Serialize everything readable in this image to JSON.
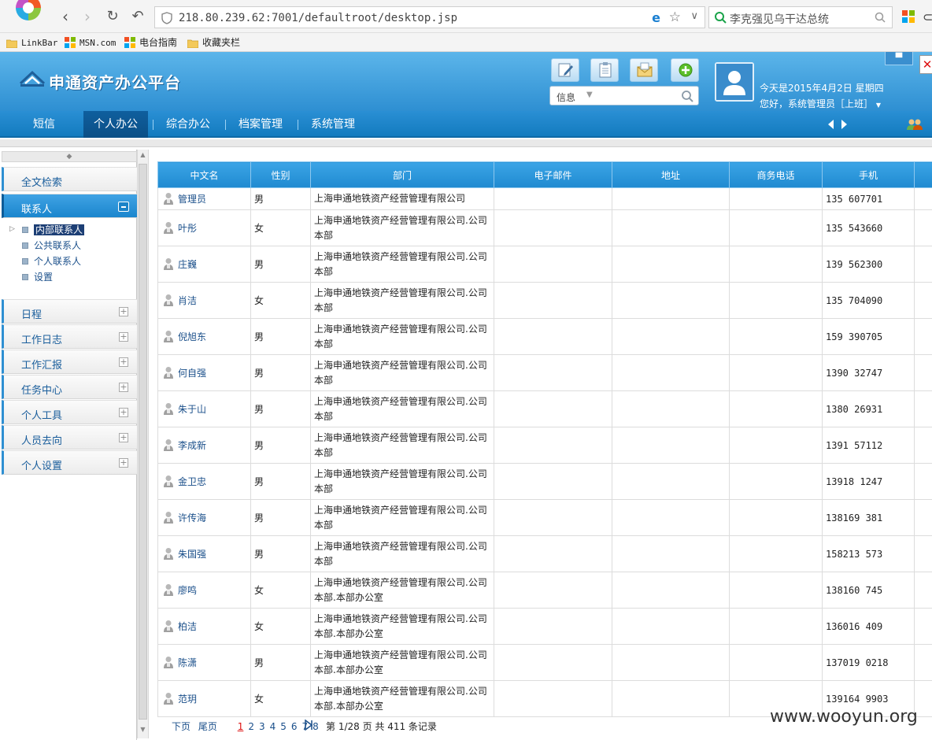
{
  "browser": {
    "url": "218.80.239.62:7001/defaultroot/desktop.jsp",
    "search_text": "李克强见乌干达总统"
  },
  "bookmarks": [
    "LinkBar",
    "MSN.com",
    "电台指南",
    "收藏夹栏"
  ],
  "app": {
    "title": "申通资产办公平台",
    "search_select": "信息",
    "date_text": "今天是2015年4月2日 星期四",
    "greeting": "您好，系统管理员［上班］"
  },
  "menu": {
    "items": [
      "短信",
      "个人办公",
      "综合办公",
      "档案管理",
      "系统管理"
    ],
    "active_index": 1
  },
  "sidebar": {
    "sections": [
      {
        "label": "全文检索"
      },
      {
        "label": "联系人"
      },
      {
        "label": "日程"
      },
      {
        "label": "工作日志"
      },
      {
        "label": "工作汇报"
      },
      {
        "label": "任务中心"
      },
      {
        "label": "个人工具"
      },
      {
        "label": "人员去向"
      },
      {
        "label": "个人设置"
      }
    ],
    "contact_items": [
      "内部联系人",
      "公共联系人",
      "个人联系人",
      "设置"
    ],
    "selected_contact": "内部联系人"
  },
  "table": {
    "columns": [
      "中文名",
      "性别",
      "部门",
      "电子邮件",
      "地址",
      "商务电话",
      "手机"
    ],
    "rows": [
      {
        "name": "管理员",
        "gender": "男",
        "dept": "上海申通地铁资产经营管理有限公司",
        "mobile": "135 607701"
      },
      {
        "name": "叶彤",
        "gender": "女",
        "dept": "上海申通地铁资产经营管理有限公司.公司本部",
        "mobile": "135 543660"
      },
      {
        "name": "庄巍",
        "gender": "男",
        "dept": "上海申通地铁资产经营管理有限公司.公司本部",
        "mobile": "139 562300"
      },
      {
        "name": "肖洁",
        "gender": "女",
        "dept": "上海申通地铁资产经营管理有限公司.公司本部",
        "mobile": "135 704090"
      },
      {
        "name": "倪旭东",
        "gender": "男",
        "dept": "上海申通地铁资产经营管理有限公司.公司本部",
        "mobile": "159 390705"
      },
      {
        "name": "何自强",
        "gender": "男",
        "dept": "上海申通地铁资产经营管理有限公司.公司本部",
        "mobile": "1390 32747"
      },
      {
        "name": "朱于山",
        "gender": "男",
        "dept": "上海申通地铁资产经营管理有限公司.公司本部",
        "mobile": "1380 26931"
      },
      {
        "name": "李成新",
        "gender": "男",
        "dept": "上海申通地铁资产经营管理有限公司.公司本部",
        "mobile": "1391 57112"
      },
      {
        "name": "金卫忠",
        "gender": "男",
        "dept": "上海申通地铁资产经营管理有限公司.公司本部",
        "mobile": "13918 1247"
      },
      {
        "name": "许传海",
        "gender": "男",
        "dept": "上海申通地铁资产经营管理有限公司.公司本部",
        "mobile": "138169 381"
      },
      {
        "name": "朱国强",
        "gender": "男",
        "dept": "上海申通地铁资产经营管理有限公司.公司本部",
        "mobile": "158213 573"
      },
      {
        "name": "廖鸣",
        "gender": "女",
        "dept": "上海申通地铁资产经营管理有限公司.公司本部.本部办公室",
        "mobile": "138160 745"
      },
      {
        "name": "柏洁",
        "gender": "女",
        "dept": "上海申通地铁资产经营管理有限公司.公司本部.本部办公室",
        "mobile": "136016 409"
      },
      {
        "name": "陈潇",
        "gender": "男",
        "dept": "上海申通地铁资产经营管理有限公司.公司本部.本部办公室",
        "mobile": "137019 0218"
      },
      {
        "name": "范玥",
        "gender": "女",
        "dept": "上海申通地铁资产经营管理有限公司.公司本部.本部办公室",
        "mobile": "139164 9903"
      }
    ]
  },
  "pager": {
    "next": "下页",
    "last": "尾页",
    "pages": [
      "1",
      "2",
      "3",
      "4",
      "5",
      "6",
      "7",
      "8"
    ],
    "current": "1",
    "info": "第 1/28 页 共 411 条记录"
  },
  "watermark": "www.wooyun.org",
  "colors": {
    "header_blue": "#2e8fd2",
    "menu_blue": "#137bbf",
    "link_blue": "#1a4f8a"
  }
}
